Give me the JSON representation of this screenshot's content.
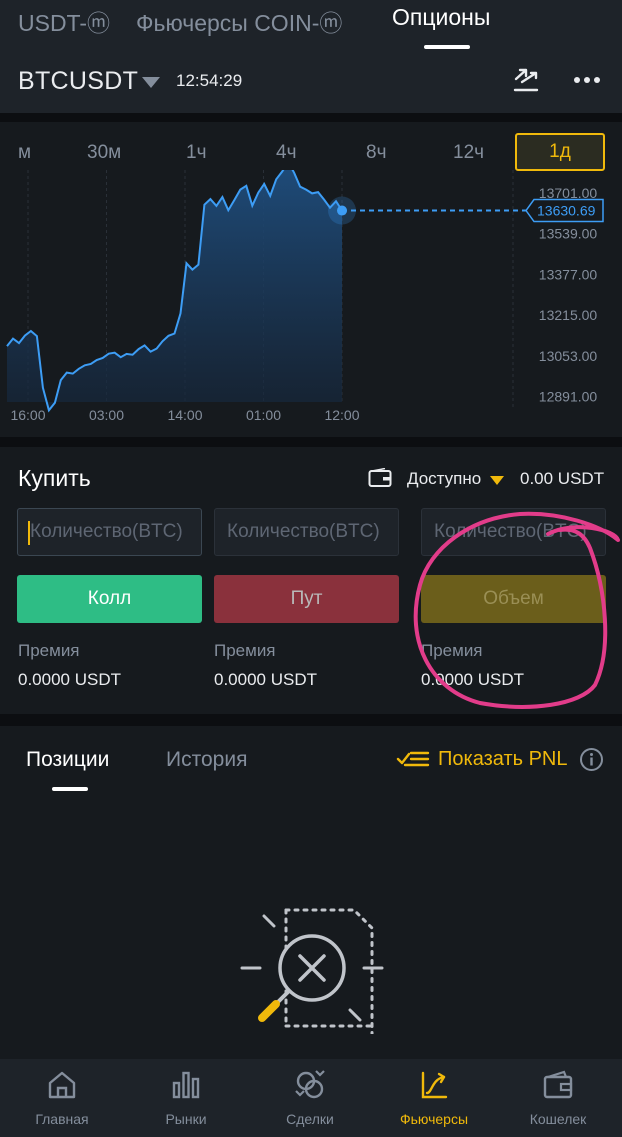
{
  "top_tabs": [
    {
      "label": "USDT-ⓜ",
      "active": false
    },
    {
      "label": "Фьючерсы COIN-ⓜ",
      "active": false
    },
    {
      "label": "Опционы",
      "active": true
    }
  ],
  "symbol": {
    "name": "BTCUSDT",
    "time": "12:54:29",
    "swap_icon": "swap-arrows-icon",
    "more_icon": "more-dots-icon"
  },
  "chart": {
    "intervals": [
      "м",
      "30м",
      "1ч",
      "4ч",
      "8ч",
      "12ч",
      "1д"
    ],
    "active_interval": "1д",
    "current_price_label": "13630.69"
  },
  "chart_data": {
    "type": "area",
    "x_ticks": [
      "16:00",
      "03:00",
      "14:00",
      "01:00",
      "12:00"
    ],
    "y_ticks": [
      13701.0,
      13539.0,
      13377.0,
      13215.0,
      13053.0,
      12891.0
    ],
    "y_tick_labels": [
      "13701.00",
      "13539.00",
      "13377.00",
      "13215.00",
      "13053.00",
      "12891.00"
    ],
    "ylim": [
      12870,
      13760
    ],
    "current_price": 13630.69,
    "series": [
      {
        "values": [
          13092,
          13122,
          13104,
          13134,
          13152,
          13132,
          12927,
          12837,
          12867,
          12957,
          12987,
          12983,
          13002,
          13016,
          13021,
          13037,
          13045,
          13062,
          13066,
          13048,
          13061,
          13058,
          13080,
          13095,
          13070,
          13082,
          13111,
          13133,
          13142,
          13222,
          13421,
          13396,
          13416,
          13654,
          13676,
          13649,
          13684,
          13632,
          13672,
          13714,
          13729,
          13650,
          13702,
          13736,
          13689,
          13755,
          13786,
          13823,
          13781,
          13726,
          13714,
          13699,
          13704,
          13674,
          13642,
          13668,
          13630.69
        ]
      }
    ]
  },
  "buy": {
    "title": "Купить",
    "wallet_icon": "wallet-icon",
    "available_label": "Доступно",
    "available_value": "0.00 USDT",
    "qty_placeholder": "Количество(BTC)",
    "call_label": "Колл",
    "put_label": "Пут",
    "volume_label": "Объем",
    "premium_label": "Премия",
    "premium_values": [
      "0.0000 USDT",
      "0.0000 USDT",
      "0.0000 USDT"
    ]
  },
  "positions": {
    "tabs": [
      "Позиции",
      "История"
    ],
    "pnl_label": "Показать PNL",
    "pnl_icon": "checklist-icon",
    "info_icon": "info-icon",
    "empty_icon": "no-results-icon"
  },
  "nav": [
    {
      "label": "Главная",
      "icon": "home-icon",
      "active": false
    },
    {
      "label": "Рынки",
      "icon": "bar-chart-icon",
      "active": false
    },
    {
      "label": "Сделки",
      "icon": "trades-icon",
      "active": false
    },
    {
      "label": "Фьючерсы",
      "icon": "futures-icon",
      "active": true
    },
    {
      "label": "Кошелек",
      "icon": "wallet-icon",
      "active": false
    }
  ],
  "colors": {
    "accent": "#f0b90b",
    "call": "#2ebd85",
    "put": "#8a313c",
    "chart_line": "#3d9df5",
    "annotation": "#e23c8a"
  }
}
